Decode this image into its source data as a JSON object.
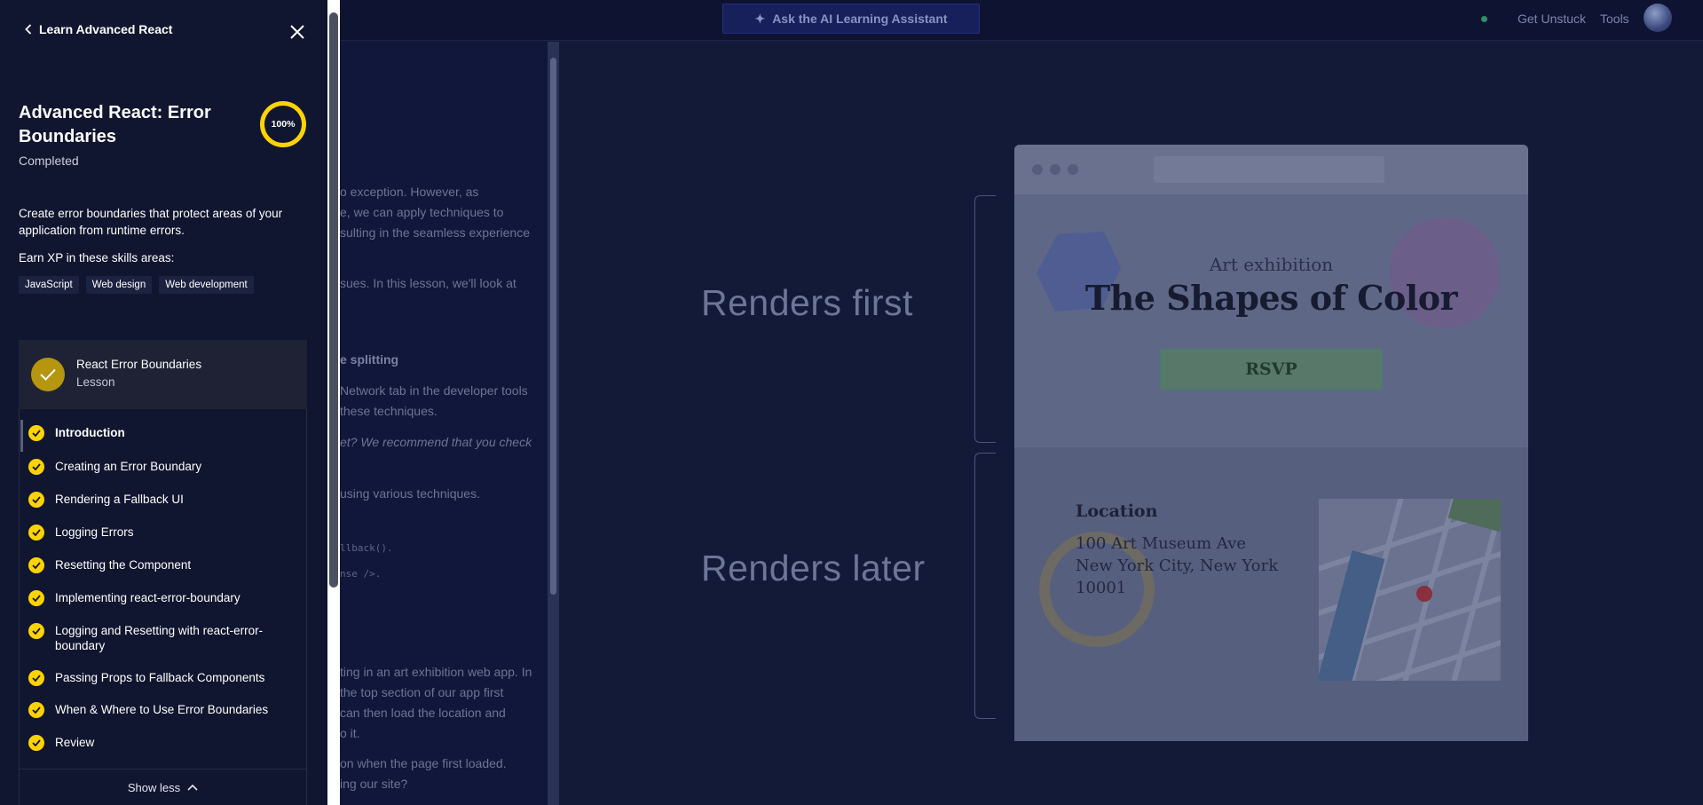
{
  "background": {
    "topbar": {
      "ask_button": "Ask the AI Learning Assistant",
      "get_unstuck": "Get Unstuck",
      "tools": "Tools"
    },
    "lesson_fragments": [
      "o exception. However, as",
      "e, we can apply techniques to",
      "sulting in the seamless experience",
      "sues. In this lesson, we'll look at",
      "e splitting",
      "Network tab in the developer tools",
      "these techniques.",
      "et? We recommend that you check",
      "using various techniques.",
      "llback().",
      "nse />.",
      "ting in an art exhibition web app. In",
      "the top section of our app first",
      "can then load the location and",
      "o it.",
      "on when the page first loaded.",
      "ing our site?"
    ],
    "diagram": {
      "renders_first": "Renders first",
      "renders_later": "Renders later",
      "art_subtitle": "Art exhibition",
      "art_title": "The Shapes of Color",
      "rsvp": "RSVP",
      "location_title": "Location",
      "address_lines": [
        "100 Art Museum Ave",
        "New York City, New York",
        "10001"
      ]
    }
  },
  "sidebar": {
    "back_label": "Learn Advanced React",
    "course_title": "Advanced React: Error Boundaries",
    "status": "Completed",
    "progress": "100%",
    "description": "Create error boundaries that protect areas of your application from runtime errors.",
    "xp_label": "Earn XP in these skills areas:",
    "skills": [
      "JavaScript",
      "Web design",
      "Web development"
    ],
    "lesson": {
      "name": "React Error Boundaries",
      "type": "Lesson"
    },
    "steps": [
      {
        "label": "Introduction",
        "current": true
      },
      {
        "label": "Creating an Error Boundary"
      },
      {
        "label": "Rendering a Fallback UI"
      },
      {
        "label": "Logging Errors"
      },
      {
        "label": "Resetting the Component"
      },
      {
        "label": "Implementing react-error-boundary"
      },
      {
        "label": "Logging and Resetting with react-error-boundary"
      },
      {
        "label": "Passing Props to Fallback Components"
      },
      {
        "label": "When & Where to Use Error Boundaries"
      },
      {
        "label": "Review"
      }
    ],
    "show_less": "Show less"
  },
  "colors": {
    "accent_yellow": "#ffd300",
    "sidebar_bg": "#10162f",
    "lesson_check": "#b5960e"
  }
}
